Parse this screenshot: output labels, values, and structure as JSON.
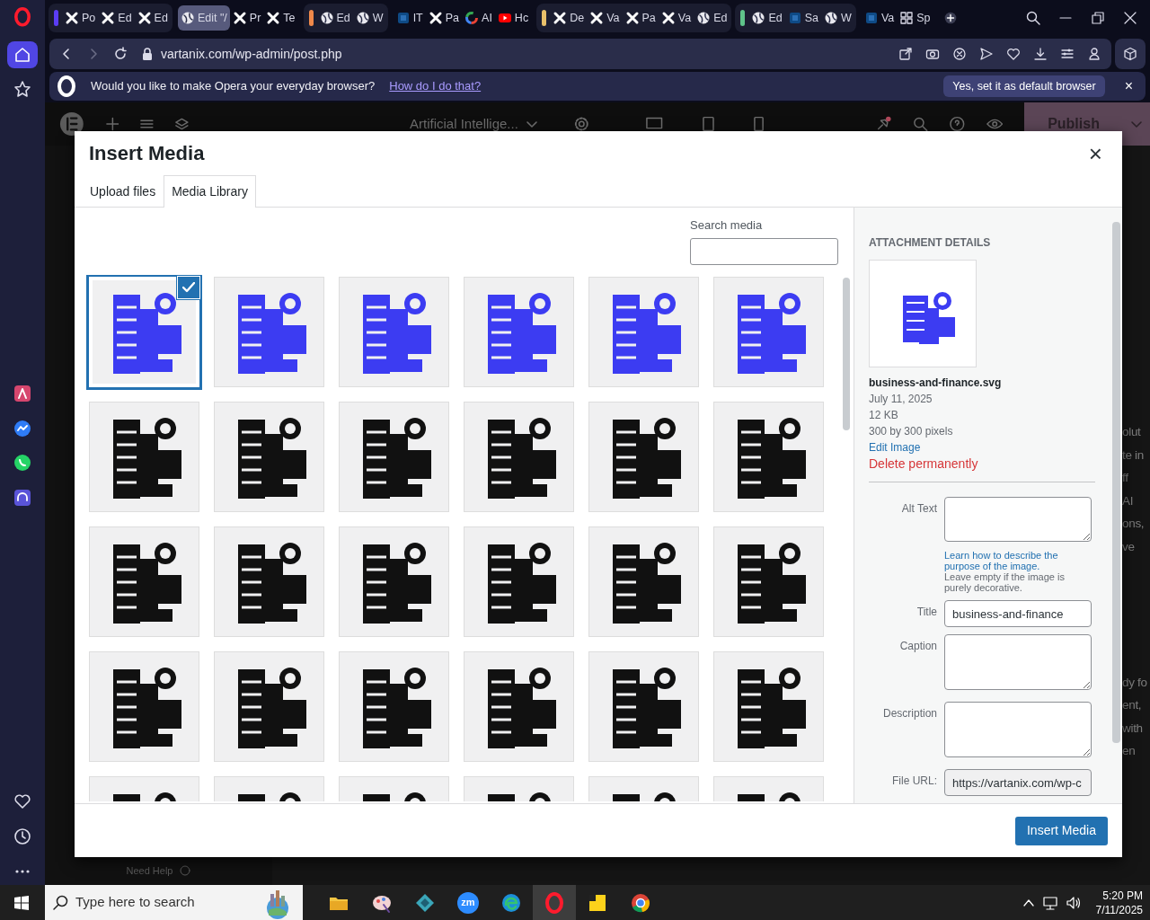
{
  "browser": {
    "tab_groups": [
      {
        "color": "#5b3df5",
        "tabs": [
          {
            "kind": "x",
            "label": "Po",
            "selected": false
          },
          {
            "kind": "x",
            "label": "Ed",
            "selected": false
          },
          {
            "kind": "x",
            "label": "Ed",
            "selected": false
          }
        ]
      },
      {
        "tabs": [
          {
            "kind": "globe",
            "label": "Edit \"/",
            "selected": true
          },
          {
            "kind": "x",
            "label": "Pr",
            "selected": false
          },
          {
            "kind": "x",
            "label": "Te",
            "selected": false
          }
        ]
      },
      {
        "color": "#f0894a",
        "tabs": [
          {
            "kind": "globe",
            "label": "Ed",
            "selected": false
          },
          {
            "kind": "globe",
            "label": "W",
            "selected": false
          }
        ]
      },
      {
        "tabs": [
          {
            "kind": "doc",
            "label": "IT",
            "selected": false
          },
          {
            "kind": "x",
            "label": "Pa",
            "selected": false
          },
          {
            "kind": "google",
            "label": "AI",
            "selected": false
          },
          {
            "kind": "video",
            "label": "Hc",
            "selected": false
          }
        ]
      },
      {
        "color": "#e9c06a",
        "tabs": [
          {
            "kind": "x",
            "label": "De",
            "selected": false
          },
          {
            "kind": "x",
            "label": "Va",
            "selected": false
          },
          {
            "kind": "x",
            "label": "Pa",
            "selected": false
          },
          {
            "kind": "x",
            "label": "Va",
            "selected": false
          },
          {
            "kind": "globe",
            "label": "Ed",
            "selected": false
          }
        ]
      },
      {
        "color": "#5fc48a",
        "tabs": [
          {
            "kind": "globe",
            "label": "Ed",
            "selected": false
          },
          {
            "kind": "doc",
            "label": "Sa",
            "selected": false
          },
          {
            "kind": "globe",
            "label": "W",
            "selected": false
          }
        ]
      },
      {
        "tabs": [
          {
            "kind": "doc",
            "label": "Va",
            "selected": false
          },
          {
            "kind": "grid",
            "label": "Sp",
            "selected": false
          }
        ]
      }
    ],
    "address": "vartanix.com/wp-admin/post.php",
    "banner": {
      "message": "Would you like to make Opera your everyday browser?",
      "link": "How do I do that?",
      "button": "Yes, set it as default browser",
      "close": "×"
    }
  },
  "sidebar": {
    "items": [
      {
        "kind": "home",
        "selected": true
      },
      {
        "kind": "star",
        "selected": false
      },
      {
        "kind": "aria",
        "selected": false
      },
      {
        "kind": "messenger",
        "selected": false
      },
      {
        "kind": "whatsapp",
        "selected": false
      },
      {
        "kind": "music",
        "selected": false
      },
      {
        "kind": "heart",
        "selected": false
      },
      {
        "kind": "clock",
        "selected": false
      },
      {
        "kind": "more",
        "selected": false
      }
    ]
  },
  "editor": {
    "document_title": "Artificial Intellige...",
    "publish": "Publish",
    "help": "Need Help",
    "text_fragments": [
      "olut",
      "te in",
      "ff",
      "AI",
      "ons,",
      "ve",
      "dy fo",
      "ent,",
      "with",
      "en"
    ]
  },
  "modal": {
    "title": "Insert Media",
    "close": "×",
    "tabs": [
      {
        "label": "Upload files",
        "selected": false
      },
      {
        "label": "Media Library",
        "selected": true
      }
    ],
    "search": {
      "label": "Search media"
    },
    "items": [
      {
        "color": "#3c3cf2",
        "selected": true
      },
      {
        "color": "#3c3cf2",
        "selected": false
      },
      {
        "color": "#3c3cf2",
        "selected": false
      },
      {
        "color": "#3c3cf2",
        "selected": false
      },
      {
        "color": "#3c3cf2",
        "selected": false
      },
      {
        "color": "#3c3cf2",
        "selected": false
      },
      {
        "color": "#111111",
        "selected": false
      },
      {
        "color": "#111111",
        "selected": false
      },
      {
        "color": "#111111",
        "selected": false
      },
      {
        "color": "#111111",
        "selected": false
      },
      {
        "color": "#111111",
        "selected": false
      },
      {
        "color": "#111111",
        "selected": false
      },
      {
        "color": "#111111",
        "selected": false
      },
      {
        "color": "#111111",
        "selected": false
      },
      {
        "color": "#111111",
        "selected": false
      },
      {
        "color": "#111111",
        "selected": false
      },
      {
        "color": "#111111",
        "selected": false
      },
      {
        "color": "#111111",
        "selected": false
      },
      {
        "color": "#111111",
        "selected": false
      },
      {
        "color": "#111111",
        "selected": false
      },
      {
        "color": "#111111",
        "selected": false
      },
      {
        "color": "#111111",
        "selected": false
      },
      {
        "color": "#111111",
        "selected": false
      },
      {
        "color": "#111111",
        "selected": false
      },
      {
        "color": "#111111",
        "selected": false
      },
      {
        "color": "#111111",
        "selected": false
      },
      {
        "color": "#111111",
        "selected": false
      },
      {
        "color": "#111111",
        "selected": false
      },
      {
        "color": "#111111",
        "selected": false
      },
      {
        "color": "#111111",
        "selected": false
      }
    ],
    "details": {
      "heading": "ATTACHMENT DETAILS",
      "filename": "business-and-finance.svg",
      "date": "July 11, 2025",
      "size": "12 KB",
      "dimensions": "300 by 300 pixels",
      "edit_link": "Edit Image",
      "delete_link": "Delete permanently",
      "help_link": "Learn how to describe the purpose of the image.",
      "help_text": "Leave empty if the image is purely decorative.",
      "fields": [
        {
          "kind": "textarea",
          "label": "Alt Text"
        },
        {
          "kind": "input",
          "label": "Title",
          "value": "business-and-finance"
        },
        {
          "kind": "textarea",
          "label": "Caption"
        },
        {
          "kind": "textarea",
          "label": "Description"
        },
        {
          "kind": "readonly",
          "label": "File URL:",
          "value": "https://vartanix.com/wp-c"
        }
      ]
    },
    "insert_button": "Insert Media"
  },
  "taskbar": {
    "search_placeholder": "Type here to search",
    "apps": [
      {
        "kind": "folder",
        "selected": false
      },
      {
        "kind": "paint",
        "selected": false
      },
      {
        "kind": "gem",
        "selected": false
      },
      {
        "kind": "zoom",
        "label": "zm",
        "selected": false
      },
      {
        "kind": "edge",
        "selected": false
      },
      {
        "kind": "opera",
        "selected": true
      },
      {
        "kind": "notes",
        "selected": false
      },
      {
        "kind": "chrome",
        "selected": false
      }
    ],
    "time": "5:20 PM",
    "date": "7/11/2025"
  }
}
